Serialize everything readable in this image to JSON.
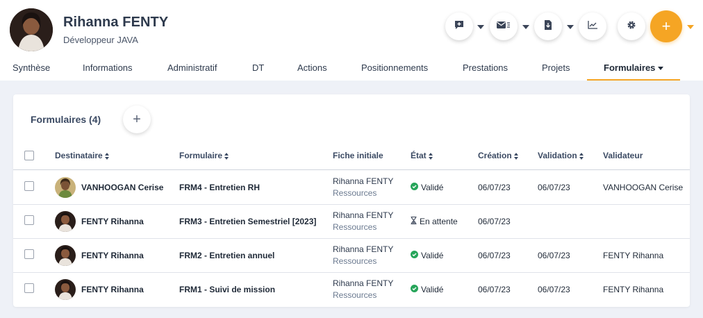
{
  "profile": {
    "name": "Rihanna FENTY",
    "role": "Développeur JAVA"
  },
  "header_actions": [
    {
      "icon": "message-add-icon"
    },
    {
      "icon": "mail-send-icon"
    },
    {
      "icon": "document-download-icon"
    },
    {
      "icon": "chart-line-icon"
    },
    {
      "icon": "gear-icon"
    },
    {
      "icon": "plus-icon",
      "label": "+"
    }
  ],
  "tabs": [
    {
      "label": "Synthèse"
    },
    {
      "label": "Informations"
    },
    {
      "label": "Administratif"
    },
    {
      "label": "DT"
    },
    {
      "label": "Actions"
    },
    {
      "label": "Positionnements"
    },
    {
      "label": "Prestations"
    },
    {
      "label": "Projets"
    },
    {
      "label": "Formulaires",
      "active": true
    }
  ],
  "colors": {
    "accent": "#f5a524",
    "valid_green": "#27a55a",
    "background": "#eef1f7"
  },
  "section": {
    "title": "Formulaires (4)",
    "add_label": "+"
  },
  "table": {
    "headers": {
      "destinataire": "Destinataire",
      "formulaire": "Formulaire",
      "fiche": "Fiche initiale",
      "etat": "État",
      "creation": "Création",
      "validation": "Validation",
      "validateur": "Validateur"
    },
    "rows": [
      {
        "destinataire": "VANHOOGAN Cerise",
        "formulaire": "FRM4  - Entretien RH",
        "fiche_name": "Rihanna FENTY",
        "fiche_type": "Ressources",
        "etat": "Validé",
        "etat_icon": "check-circle-icon",
        "creation": "06/07/23",
        "validation": "06/07/23",
        "validateur": "VANHOOGAN Cerise"
      },
      {
        "destinataire": "FENTY Rihanna",
        "formulaire": "FRM3  - Entretien Semestriel [2023]",
        "fiche_name": "Rihanna FENTY",
        "fiche_type": "Ressources",
        "etat": "En attente",
        "etat_icon": "hourglass-icon",
        "creation": "06/07/23",
        "validation": "",
        "validateur": ""
      },
      {
        "destinataire": "FENTY Rihanna",
        "formulaire": "FRM2  - Entretien annuel",
        "fiche_name": "Rihanna FENTY",
        "fiche_type": "Ressources",
        "etat": "Validé",
        "etat_icon": "check-circle-icon",
        "creation": "06/07/23",
        "validation": "06/07/23",
        "validateur": "FENTY Rihanna"
      },
      {
        "destinataire": "FENTY Rihanna",
        "formulaire": "FRM1  - Suivi de mission",
        "fiche_name": "Rihanna FENTY",
        "fiche_type": "Ressources",
        "etat": "Validé",
        "etat_icon": "check-circle-icon",
        "creation": "06/07/23",
        "validation": "06/07/23",
        "validateur": "FENTY Rihanna"
      }
    ]
  }
}
